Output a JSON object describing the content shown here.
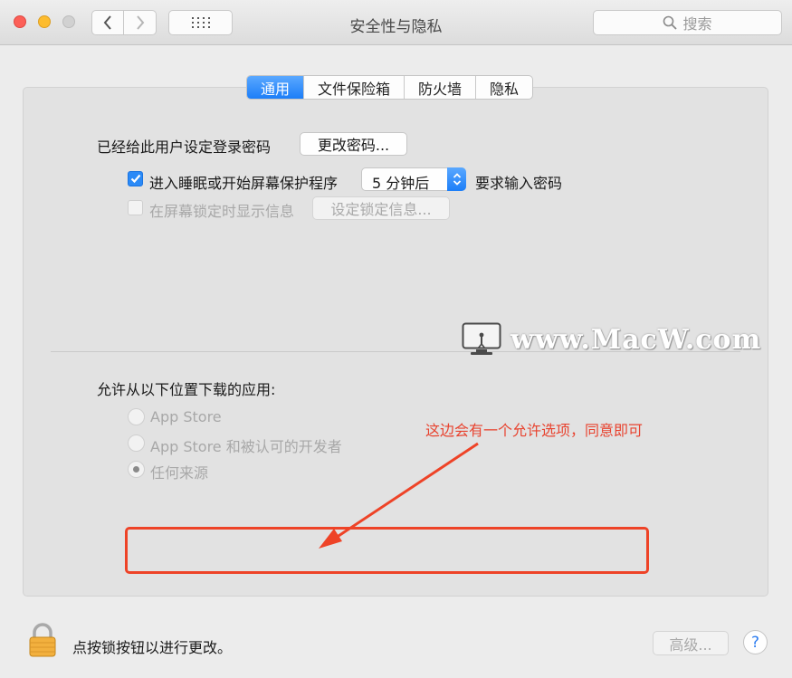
{
  "window": {
    "title": "安全性与隐私"
  },
  "toolbar": {
    "search_placeholder": "搜索"
  },
  "tabs": [
    {
      "label": "通用",
      "active": true
    },
    {
      "label": "文件保险箱",
      "active": false
    },
    {
      "label": "防火墙",
      "active": false
    },
    {
      "label": "隐私",
      "active": false
    }
  ],
  "general": {
    "password_set_label": "已经给此用户设定登录密码",
    "change_password_button": "更改密码...",
    "require_password_label": "进入睡眠或开始屏幕保护程序",
    "require_password_checked": true,
    "require_password_delay": "5 分钟后",
    "require_password_suffix": "要求输入密码",
    "show_message_label": "在屏幕锁定时显示信息",
    "show_message_checked": false,
    "set_lock_message_button": "设定锁定信息..."
  },
  "gatekeeper": {
    "heading": "允许从以下位置下载的应用:",
    "options": [
      {
        "label": "App Store",
        "selected": false
      },
      {
        "label": "App Store 和被认可的开发者",
        "selected": false
      },
      {
        "label": "任何来源",
        "selected": true
      }
    ]
  },
  "watermark": {
    "text": "www.MacW.com"
  },
  "annotation": {
    "note": "这边会有一个允许选项，同意即可",
    "color": "#e8432f"
  },
  "footer": {
    "lock_text": "点按锁按钮以进行更改。",
    "advanced_button": "高级...",
    "help_button": "?"
  },
  "colors": {
    "accent": "#1c7ef8",
    "annotation_red": "#ee4327"
  },
  "icons": [
    "back-arrow-icon",
    "forward-arrow-icon",
    "grid-icon",
    "search-icon",
    "checkmark-icon",
    "updown-arrows-icon",
    "monitor-logo-icon",
    "lock-icon",
    "help-icon"
  ]
}
